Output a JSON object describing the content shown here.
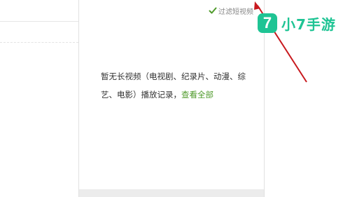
{
  "filter": {
    "label": "过滤短视频",
    "checked": true
  },
  "empty_message": {
    "text": "暂无长视频（电视剧、纪录片、动漫、综艺、电影）播放记录，",
    "link": "查看全部"
  },
  "logo": {
    "badge": "7",
    "text": "小7手游",
    "color": "#1fc494"
  },
  "colors": {
    "accent_link": "#4e9a2a",
    "annotation_arrow": "#c8191e"
  }
}
